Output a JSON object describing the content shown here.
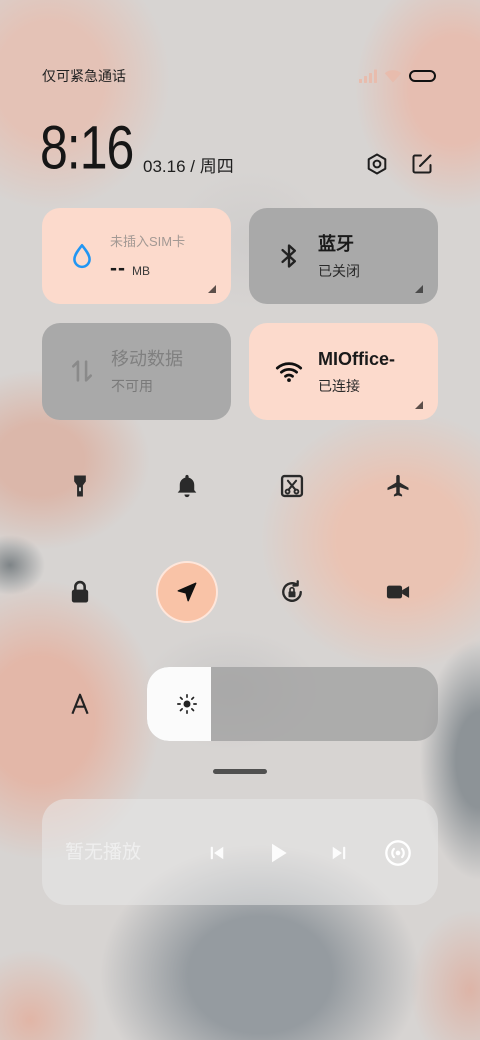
{
  "status_bar": {
    "carrier_text": "仅可紧急通话",
    "icons": [
      "signal-icon",
      "wifi-icon",
      "battery-icon"
    ]
  },
  "header": {
    "time": "8:16",
    "date": "03.16 / 周四",
    "icons": [
      "settings-icon",
      "edit-icon"
    ]
  },
  "tiles": {
    "data_usage": {
      "title": "未插入SIM卡",
      "value": "--",
      "unit": "MB",
      "icon": "water-drop-icon",
      "active": true
    },
    "bluetooth": {
      "title": "蓝牙",
      "status": "已关闭",
      "icon": "bluetooth-icon",
      "active": false
    },
    "mobile_data": {
      "title": "移动数据",
      "status": "不可用",
      "icon": "mobile-data-icon",
      "active": false,
      "disabled": true
    },
    "wifi": {
      "title": "MIOffice-",
      "status": "已连接",
      "icon": "wifi-icon",
      "active": true
    }
  },
  "toggles": [
    {
      "icon": "flashlight-icon",
      "active": false
    },
    {
      "icon": "bell-icon",
      "active": false
    },
    {
      "icon": "screenshot-icon",
      "active": false
    },
    {
      "icon": "airplane-icon",
      "active": false
    },
    {
      "icon": "lock-icon",
      "active": false
    },
    {
      "icon": "location-arrow-icon",
      "active": true
    },
    {
      "icon": "rotation-lock-icon",
      "active": false
    },
    {
      "icon": "video-camera-icon",
      "active": false
    }
  ],
  "brightness": {
    "level": 0.22,
    "icons": [
      "auto-brightness-icon",
      "sun-icon"
    ]
  },
  "media": {
    "status": "暂无播放",
    "controls": [
      "previous-icon",
      "play-icon",
      "next-icon",
      "cast-icon"
    ]
  },
  "colors": {
    "active_tile": "#fcdacc",
    "inactive_tile": "#a9a9a9",
    "active_toggle": "#f9c3a7",
    "drop_blue": "#2196f3"
  }
}
